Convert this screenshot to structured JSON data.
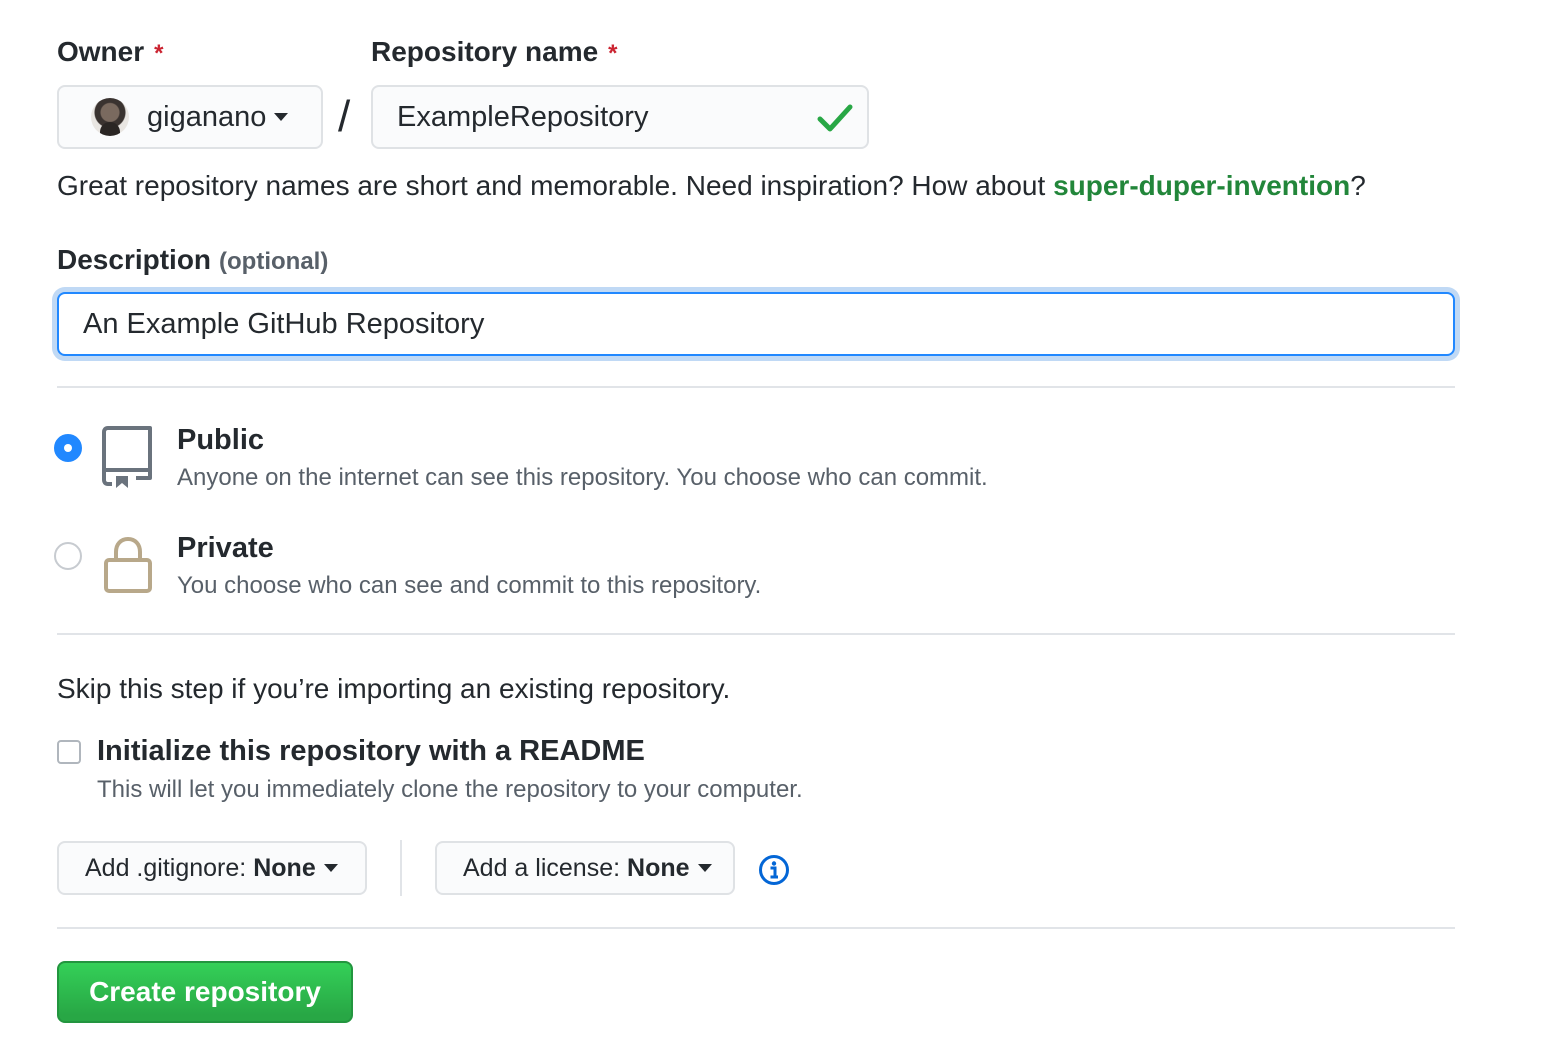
{
  "owner": {
    "label": "Owner",
    "required_mark": "*",
    "value": "giganano"
  },
  "separator": "/",
  "repository_name": {
    "label": "Repository name",
    "required_mark": "*",
    "value": "ExampleRepository",
    "status_icon": "check-icon"
  },
  "hint": {
    "text": "Great repository names are short and memorable. Need inspiration? How about ",
    "suggestion": "super-duper-invention",
    "suffix": "?"
  },
  "description": {
    "label": "Description",
    "optional": "(optional)",
    "value": "An Example GitHub Repository"
  },
  "visibility": {
    "public": {
      "title": "Public",
      "description": "Anyone on the internet can see this repository. You choose who can commit.",
      "icon": "repo-icon",
      "checked": true
    },
    "private": {
      "title": "Private",
      "description": "You choose who can see and commit to this repository.",
      "icon": "lock-icon",
      "checked": false
    }
  },
  "skip_text": "Skip this step if you’re importing an existing repository.",
  "readme": {
    "title": "Initialize this repository with a README",
    "description": "This will let you immediately clone the repository to your computer.",
    "checked": false
  },
  "gitignore": {
    "label": "Add .gitignore:",
    "value": "None"
  },
  "license": {
    "label": "Add a license:",
    "value": "None"
  },
  "create_button": "Create repository",
  "colors": {
    "primary_green": "#28a745",
    "focus_blue": "#2188ff",
    "suggestion_green": "#22863a",
    "required_red": "#cb2431",
    "info_blue": "#0366d6",
    "lock_tan": "#b8a88a"
  }
}
